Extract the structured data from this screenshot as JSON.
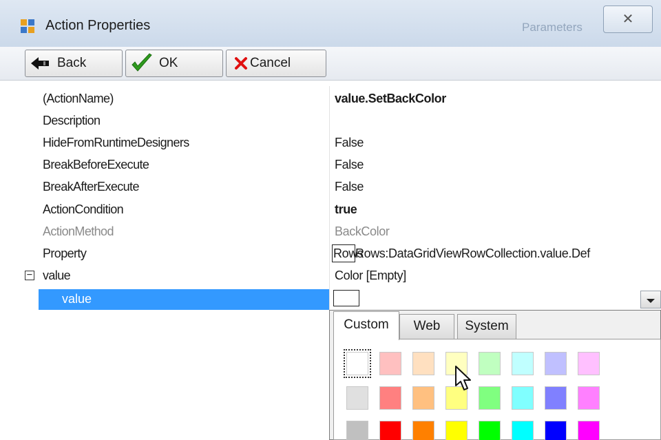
{
  "window": {
    "title": "Action Properties",
    "background_hint": "Parameters",
    "close_glyph": "✕"
  },
  "toolbar": {
    "back_label": "Back",
    "ok_label": "OK",
    "cancel_label": "Cancel"
  },
  "properties": [
    {
      "name": "(ActionName)",
      "value": "value.SetBackColor",
      "style": "bold"
    },
    {
      "name": "Description",
      "value": "",
      "style": "normal"
    },
    {
      "name": "HideFromRuntimeDesigners",
      "value": "False",
      "style": "normal"
    },
    {
      "name": "BreakBeforeExecute",
      "value": "False",
      "style": "normal"
    },
    {
      "name": "BreakAfterExecute",
      "value": "False",
      "style": "normal"
    },
    {
      "name": "ActionCondition",
      "value": "true",
      "style": "bold"
    },
    {
      "name": "ActionMethod",
      "value": "BackColor",
      "style": "disabled"
    },
    {
      "name": "Property",
      "value": "Rows:DataGridViewRowCollection.value.Def",
      "style": "normal",
      "prefix": "Rows"
    },
    {
      "name": "value",
      "value": "Color [Empty]",
      "style": "normal",
      "expander": "−"
    }
  ],
  "selected_property": {
    "name": "value",
    "value": ""
  },
  "color_picker": {
    "tabs": [
      "Custom",
      "Web",
      "System"
    ],
    "active_tab": "Custom",
    "palette": [
      [
        "#ffffff",
        "#ffc0c0",
        "#ffe0c0",
        "#ffffc0",
        "#c0ffc0",
        "#c0ffff",
        "#c0c0ff",
        "#ffc0ff"
      ],
      [
        "#e0e0e0",
        "#ff8080",
        "#ffc080",
        "#ffff80",
        "#80ff80",
        "#80ffff",
        "#8080ff",
        "#ff80ff"
      ],
      [
        "#c0c0c0",
        "#ff0000",
        "#ff8000",
        "#ffff00",
        "#00ff00",
        "#00ffff",
        "#0000ff",
        "#ff00ff"
      ]
    ],
    "selected_swatch": "#ffffff"
  },
  "colors": {
    "selection": "#3399ff",
    "titlebar": "#cbd9ea"
  }
}
